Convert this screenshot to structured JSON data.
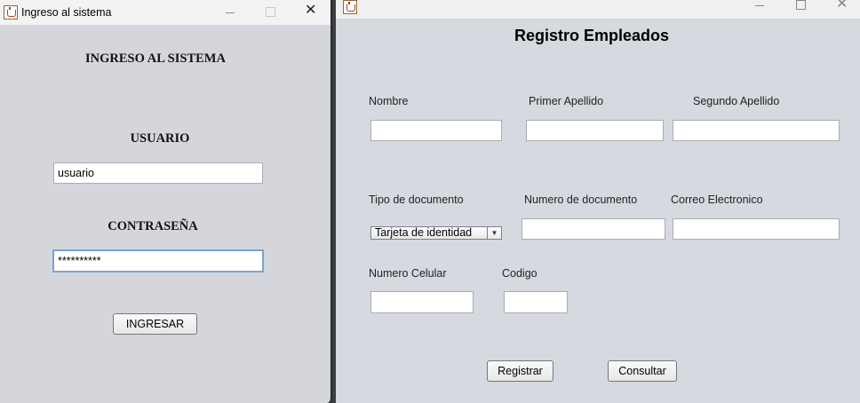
{
  "login_window": {
    "title": "Ingreso al sistema",
    "heading": "INGRESO AL SISTEMA",
    "user_label": "USUARIO",
    "user_value": "usuario",
    "password_label": "CONTRASEÑA",
    "password_value": "**********",
    "submit_label": "INGRESAR"
  },
  "register_window": {
    "heading": "Registro Empleados",
    "fields": {
      "nombre_label": "Nombre",
      "primer_apellido_label": "Primer Apellido",
      "segundo_apellido_label": "Segundo Apellido",
      "tipo_documento_label": "Tipo de documento",
      "tipo_documento_value": "Tarjeta de identidad",
      "numero_documento_label": "Numero de documento",
      "correo_label": "Correo Electronico",
      "celular_label": "Numero Celular",
      "codigo_label": "Codigo"
    },
    "buttons": {
      "registrar": "Registrar",
      "consultar": "Consultar"
    }
  }
}
